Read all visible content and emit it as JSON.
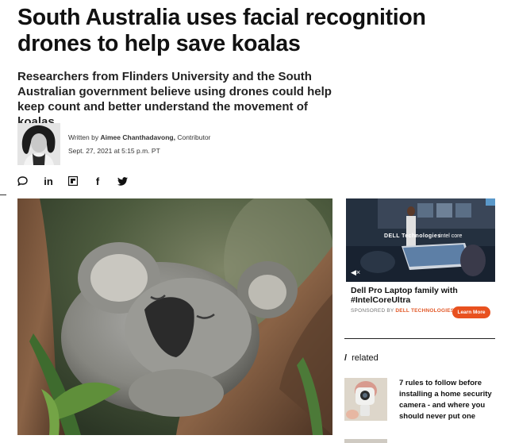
{
  "article": {
    "headline": "South Australia uses facial recognition drones to help save koalas",
    "dek": "Researchers from Flinders University and the South Australian government believe using drones could help keep count and better understand the movement of koalas.",
    "byline_prefix": "Written by",
    "author": "Aimee Chanthadavong,",
    "author_role": "Contributor",
    "date": "Sept. 27, 2021 at 5:15 p.m. PT"
  },
  "share": {
    "icons": [
      "comment-icon",
      "linkedin-icon",
      "flipboard-icon",
      "facebook-icon",
      "twitter-icon"
    ],
    "labels": {
      "linkedin": "in",
      "facebook": "f"
    }
  },
  "ad": {
    "title": "Dell Pro Laptop family with #IntelCoreUltra",
    "sponsored_prefix": "SPONSORED BY",
    "sponsor": "DELL TECHNOLOGIES",
    "cta": "Learn More",
    "video_brand": "DELL Technologies",
    "video_partner": "intel core",
    "colors": {
      "cta": "#e8511f",
      "sponsor": "#e25a2a"
    }
  },
  "related": {
    "heading_slash": "/",
    "heading": "related",
    "items": [
      {
        "title": "7 rules to follow before installing a home security camera - and where you should never put one"
      }
    ]
  }
}
